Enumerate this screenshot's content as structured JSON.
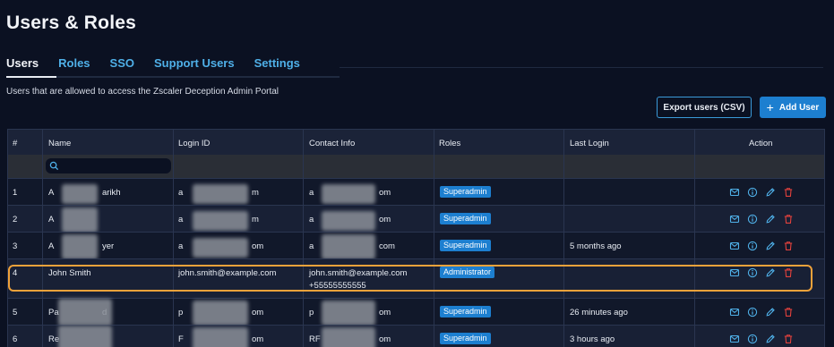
{
  "page": {
    "title": "Users & Roles",
    "subtitle": "Users that are allowed to access the Zscaler Deception Admin Portal"
  },
  "tabs": [
    {
      "label": "Users",
      "active": true
    },
    {
      "label": "Roles",
      "active": false
    },
    {
      "label": "SSO",
      "active": false
    },
    {
      "label": "Support Users",
      "active": false
    },
    {
      "label": "Settings",
      "active": false
    }
  ],
  "buttons": {
    "export_label": "Export users (CSV)",
    "add_label": "Add User",
    "add_icon": "+"
  },
  "table": {
    "headers": [
      "#",
      "Name",
      "Login ID",
      "Contact Info",
      "Roles",
      "Last Login",
      "Action"
    ],
    "search_placeholder": "",
    "rows": [
      {
        "num": "1",
        "name": "A",
        "name_tail": "arikh",
        "login": "a",
        "login_tail": "m",
        "contact": "a",
        "contact_tail": "om",
        "contact2": "",
        "role": "Superadmin",
        "last": ""
      },
      {
        "num": "2",
        "name": "A",
        "name_tail": "",
        "login": "a",
        "login_tail": "m",
        "contact": "a",
        "contact_tail": "om",
        "contact2": "",
        "role": "Superadmin",
        "last": ""
      },
      {
        "num": "3",
        "name": "A",
        "name_tail": "yer",
        "login": "a",
        "login_tail": "om",
        "contact": "a",
        "contact_tail": "com",
        "contact2": "",
        "role": "Superadmin",
        "last": "5 months ago"
      },
      {
        "num": "4",
        "name": "John Smith",
        "name_tail": "",
        "login": "john.smith@example.com",
        "login_tail": "",
        "contact": "john.smith@example.com",
        "contact_tail": "",
        "contact2": "+55555555555",
        "role": "Administrator",
        "last": ""
      },
      {
        "num": "5",
        "name": "Pa",
        "name_tail": "d",
        "login": "p",
        "login_tail": "om",
        "contact": "p",
        "contact_tail": "om",
        "contact2": "",
        "role": "Superadmin",
        "last": "26 minutes ago"
      },
      {
        "num": "6",
        "name": "Re",
        "name_tail": "",
        "login": "F",
        "login_tail": "om",
        "contact": "RF",
        "contact_tail": "om",
        "contact2": "",
        "role": "Superadmin",
        "last": "3 hours ago"
      }
    ],
    "action_icons": [
      "mail-icon",
      "info-icon",
      "edit-icon",
      "delete-icon"
    ]
  },
  "colors": {
    "background": "#0b1122",
    "accent": "#1d7fd0",
    "tab_link": "#4fb0e8",
    "highlight": "#f0a23a",
    "delete": "#e0413c"
  }
}
